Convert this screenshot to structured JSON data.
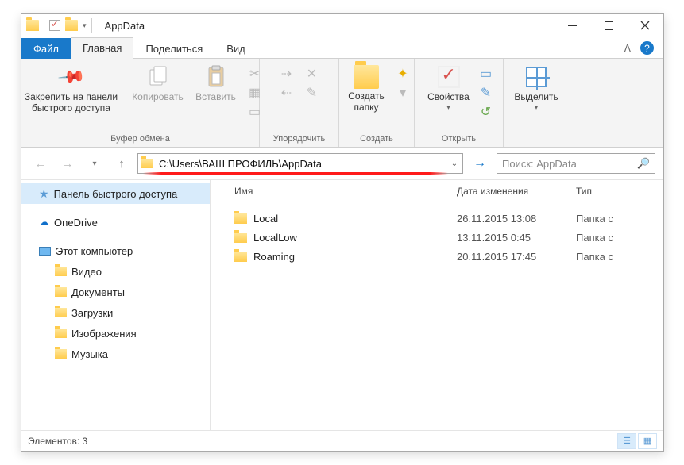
{
  "title": "AppData",
  "tabs": {
    "file": "Файл",
    "home": "Главная",
    "share": "Поделиться",
    "view": "Вид"
  },
  "ribbon": {
    "pin": "Закрепить на панели быстрого доступа",
    "copy": "Копировать",
    "paste": "Вставить",
    "group_clipboard": "Буфер обмена",
    "group_organize": "Упорядочить",
    "new_folder": "Создать папку",
    "group_new": "Создать",
    "properties": "Свойства",
    "group_open": "Открыть",
    "select": "Выделить"
  },
  "address_path": "C:\\Users\\ВАШ ПРОФИЛЬ\\AppData",
  "search_placeholder": "Поиск: AppData",
  "sidebar": {
    "quick": "Панель быстрого доступа",
    "onedrive": "OneDrive",
    "thispc": "Этот компьютер",
    "video": "Видео",
    "documents": "Документы",
    "downloads": "Загрузки",
    "pictures": "Изображения",
    "music": "Музыка"
  },
  "columns": {
    "name": "Имя",
    "date": "Дата изменения",
    "type": "Тип"
  },
  "rows": [
    {
      "name": "Local",
      "date": "26.11.2015 13:08",
      "type": "Папка с"
    },
    {
      "name": "LocalLow",
      "date": "13.11.2015 0:45",
      "type": "Папка с"
    },
    {
      "name": "Roaming",
      "date": "20.11.2015 17:45",
      "type": "Папка с"
    }
  ],
  "status_elements": "Элементов: 3"
}
